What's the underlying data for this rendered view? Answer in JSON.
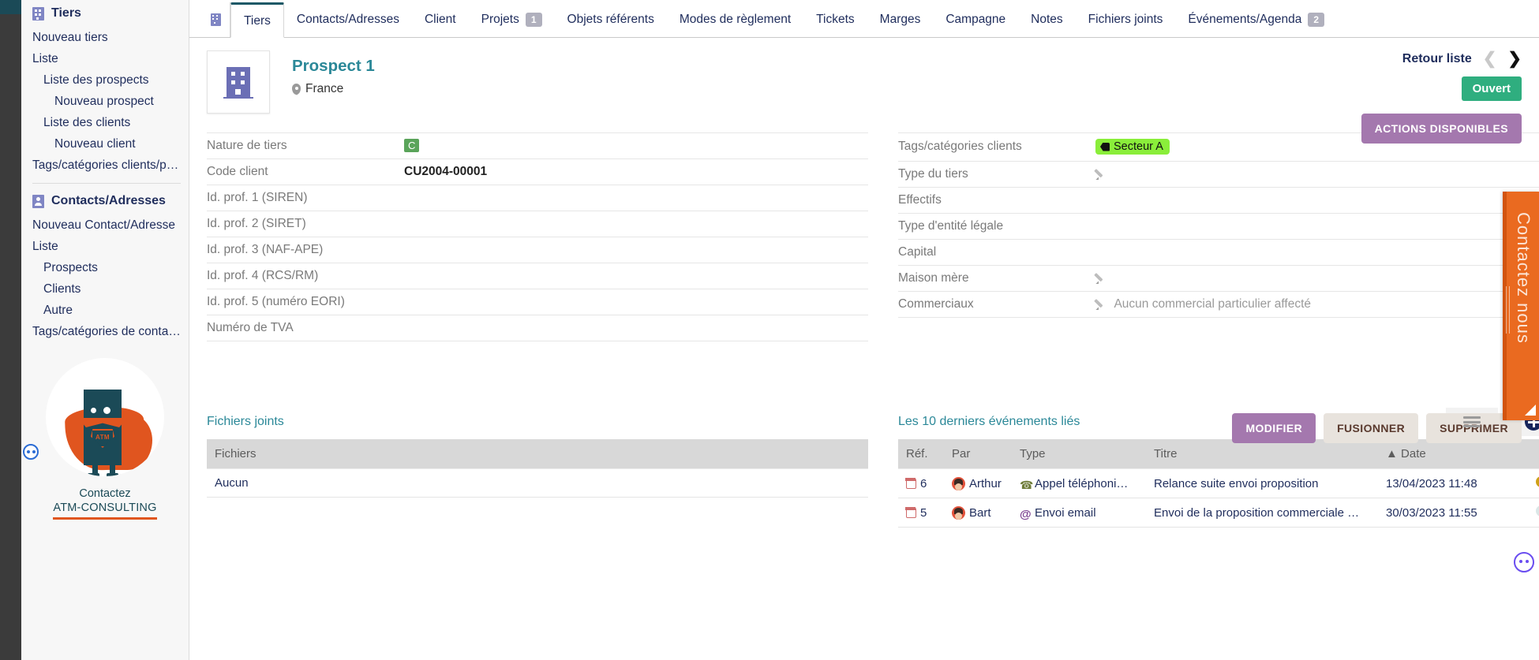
{
  "sidebar": {
    "groups": [
      {
        "icon": "building-icon",
        "title": "Tiers",
        "items": [
          {
            "label": "Nouveau tiers",
            "level": 0
          },
          {
            "label": "Liste",
            "level": 0
          },
          {
            "label": "Liste des prospects",
            "level": 1
          },
          {
            "label": "Nouveau prospect",
            "level": 2
          },
          {
            "label": "Liste des clients",
            "level": 1
          },
          {
            "label": "Nouveau client",
            "level": 2
          },
          {
            "label": "Tags/catégories clients/pr…",
            "level": 0
          }
        ]
      },
      {
        "icon": "contact-card-icon",
        "title": "Contacts/Adresses",
        "items": [
          {
            "label": "Nouveau Contact/Adresse",
            "level": 0
          },
          {
            "label": "Liste",
            "level": 0
          },
          {
            "label": "Prospects",
            "level": 1
          },
          {
            "label": "Clients",
            "level": 1
          },
          {
            "label": "Autre",
            "level": 1
          },
          {
            "label": "Tags/catégories de conta…",
            "level": 0
          }
        ]
      }
    ],
    "logo_alt": "ATM superhero mascot",
    "logo_emblem": "ATM",
    "contact_line1": "Contactez",
    "contact_line2": "ATM-CONSULTING"
  },
  "tabs": [
    {
      "label": "Tiers",
      "active": true,
      "badge": ""
    },
    {
      "label": "Contacts/Adresses",
      "active": false,
      "badge": ""
    },
    {
      "label": "Client",
      "active": false,
      "badge": ""
    },
    {
      "label": "Projets",
      "active": false,
      "badge": "1"
    },
    {
      "label": "Objets référents",
      "active": false,
      "badge": ""
    },
    {
      "label": "Modes de règlement",
      "active": false,
      "badge": ""
    },
    {
      "label": "Tickets",
      "active": false,
      "badge": ""
    },
    {
      "label": "Marges",
      "active": false,
      "badge": ""
    },
    {
      "label": "Campagne",
      "active": false,
      "badge": ""
    },
    {
      "label": "Notes",
      "active": false,
      "badge": ""
    },
    {
      "label": "Fichiers joints",
      "active": false,
      "badge": ""
    },
    {
      "label": "Événements/Agenda",
      "active": false,
      "badge": "2"
    }
  ],
  "header": {
    "title": "Prospect 1",
    "country": "France",
    "back_to_list": "Retour liste",
    "prev_icon": "chevron-left-icon",
    "next_icon": "chevron-right-icon",
    "status_label": "Ouvert",
    "status_color": "#2fae7f",
    "actions_label": "ACTIONS DISPONIBLES",
    "actions_color": "#a478ae"
  },
  "fields_left": [
    {
      "label": "Nature de tiers",
      "value": "C",
      "type": "badge"
    },
    {
      "label": "Code client",
      "value": "CU2004-00001",
      "type": "strong"
    },
    {
      "label": "Id. prof. 1 (SIREN)",
      "value": "",
      "type": "text"
    },
    {
      "label": "Id. prof. 2 (SIRET)",
      "value": "",
      "type": "text"
    },
    {
      "label": "Id. prof. 3 (NAF-APE)",
      "value": "",
      "type": "text"
    },
    {
      "label": "Id. prof. 4 (RCS/RM)",
      "value": "",
      "type": "text"
    },
    {
      "label": "Id. prof. 5 (numéro EORI)",
      "value": "",
      "type": "text"
    },
    {
      "label": "Numéro de TVA",
      "value": "",
      "type": "text"
    }
  ],
  "fields_right": [
    {
      "label": "Tags/catégories clients",
      "value": "Secteur A",
      "type": "tag"
    },
    {
      "label": "Type du tiers",
      "value": "",
      "type": "pencil"
    },
    {
      "label": "Effectifs",
      "value": "",
      "type": "text"
    },
    {
      "label": "Type d'entité légale",
      "value": "",
      "type": "text"
    },
    {
      "label": "Capital",
      "value": "",
      "type": "text"
    },
    {
      "label": "Maison mère",
      "value": "",
      "type": "pencil"
    },
    {
      "label": "Commerciaux",
      "value": "Aucun commercial particulier affecté",
      "type": "pencil-muted"
    }
  ],
  "record_actions": [
    {
      "label": "MODIFIER",
      "style": "primary"
    },
    {
      "label": "FUSIONNER",
      "style": "plain"
    },
    {
      "label": "SUPPRIMER",
      "style": "plain"
    }
  ],
  "attachments_panel": {
    "title": "Fichiers joints",
    "column": "Fichiers",
    "empty": "Aucun"
  },
  "events_panel": {
    "title": "Les 10 derniers événements liés",
    "list_icon": "list-view-icon",
    "add_icon": "add-circle-icon",
    "columns": [
      "Réf.",
      "Par",
      "Type",
      "Titre",
      "Date"
    ],
    "sort_indicator": "▲",
    "rows": [
      {
        "ref": "6",
        "par": "Arthur",
        "type": "Appel téléphoni…",
        "type_icon": "phone-icon",
        "titre": "Relance suite envoi proposition",
        "date": "13/04/2023 11:48",
        "status_color": "#cfa017"
      },
      {
        "ref": "5",
        "par": "Bart",
        "type": "Envoi email",
        "type_icon": "at-icon",
        "titre": "Envoi de la proposition commerciale …",
        "date": "30/03/2023 11:55",
        "status_color": "#dbe7e7"
      }
    ]
  },
  "contact_tab": {
    "label": "Contactez nous",
    "color": "#ea6a20"
  }
}
